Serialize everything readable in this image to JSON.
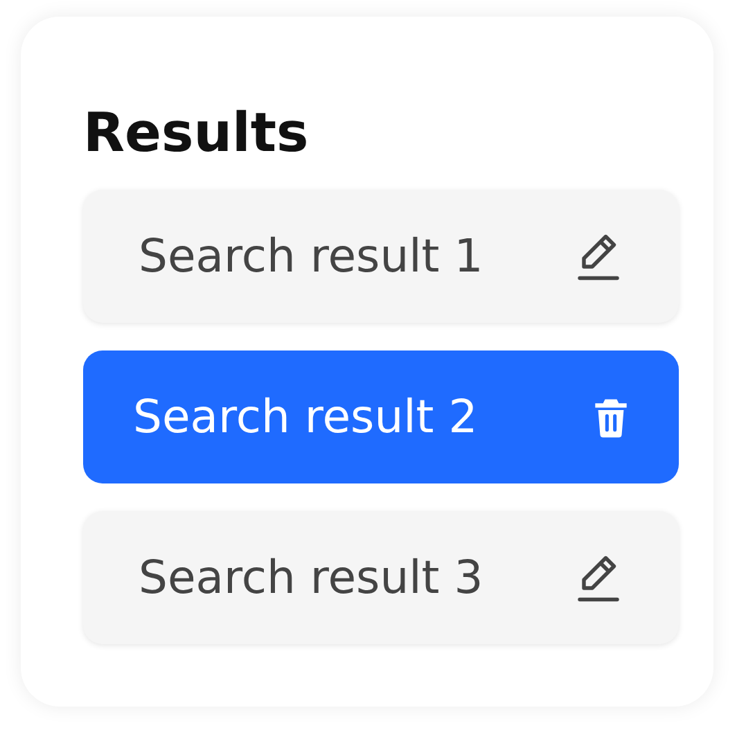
{
  "title": "Results",
  "items": [
    {
      "label": "Search result 1",
      "selected": false
    },
    {
      "label": "Search result 2",
      "selected": true
    },
    {
      "label": "Search result 3",
      "selected": false
    }
  ]
}
